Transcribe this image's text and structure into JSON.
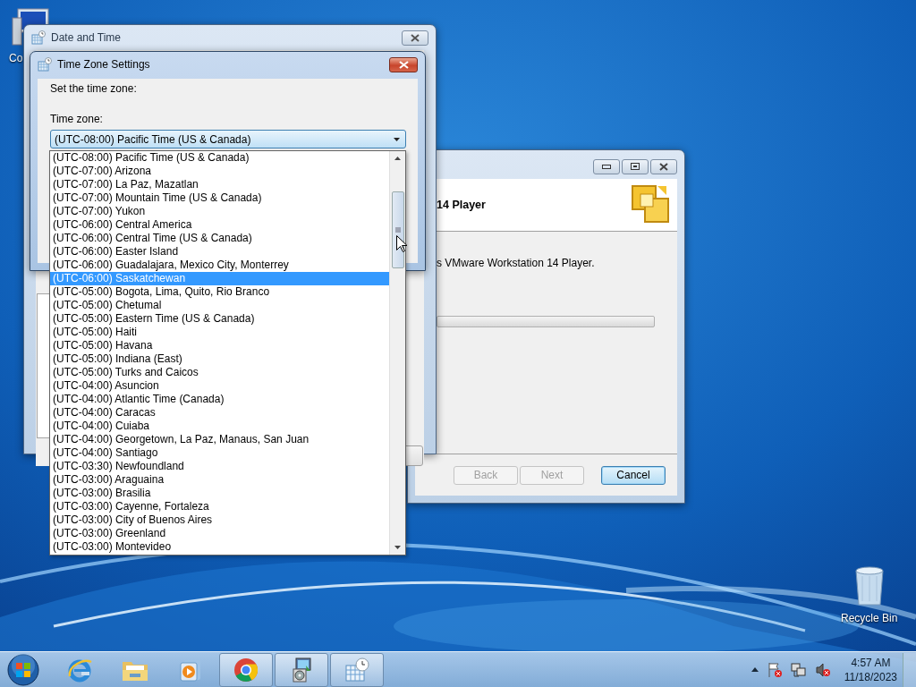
{
  "desktop": {
    "computer_label": "Co",
    "recycle_bin_label": "Recycle Bin"
  },
  "installer_window": {
    "heading": "14 Player",
    "description": "s VMware Workstation 14 Player.",
    "progress": {
      "level": 0
    },
    "buttons": [
      {
        "label": "Back",
        "disabled": true,
        "focused": false
      },
      {
        "label": "Next",
        "disabled": true,
        "focused": false
      },
      {
        "label": "Cancel",
        "disabled": false,
        "focused": true
      }
    ]
  },
  "date_time_window": {
    "title": "Date and Time"
  },
  "time_zone_dialog": {
    "title": "Time Zone Settings",
    "prompt": "Set the time zone:",
    "field_label": "Time zone:",
    "combo_value": "(UTC-08:00) Pacific Time (US & Canada)",
    "options": [
      {
        "label": "(UTC-08:00) Pacific Time (US & Canada)",
        "selected": false
      },
      {
        "label": "(UTC-07:00) Arizona",
        "selected": false
      },
      {
        "label": "(UTC-07:00) La Paz, Mazatlan",
        "selected": false
      },
      {
        "label": "(UTC-07:00) Mountain Time (US & Canada)",
        "selected": false
      },
      {
        "label": "(UTC-07:00) Yukon",
        "selected": false
      },
      {
        "label": "(UTC-06:00) Central America",
        "selected": false
      },
      {
        "label": "(UTC-06:00) Central Time (US & Canada)",
        "selected": false
      },
      {
        "label": "(UTC-06:00) Easter Island",
        "selected": false
      },
      {
        "label": "(UTC-06:00) Guadalajara, Mexico City, Monterrey",
        "selected": false
      },
      {
        "label": "(UTC-06:00) Saskatchewan",
        "selected": true
      },
      {
        "label": "(UTC-05:00) Bogota, Lima, Quito, Rio Branco",
        "selected": false
      },
      {
        "label": "(UTC-05:00) Chetumal",
        "selected": false
      },
      {
        "label": "(UTC-05:00) Eastern Time (US & Canada)",
        "selected": false
      },
      {
        "label": "(UTC-05:00) Haiti",
        "selected": false
      },
      {
        "label": "(UTC-05:00) Havana",
        "selected": false
      },
      {
        "label": "(UTC-05:00) Indiana (East)",
        "selected": false
      },
      {
        "label": "(UTC-05:00) Turks and Caicos",
        "selected": false
      },
      {
        "label": "(UTC-04:00) Asuncion",
        "selected": false
      },
      {
        "label": "(UTC-04:00) Atlantic Time (Canada)",
        "selected": false
      },
      {
        "label": "(UTC-04:00) Caracas",
        "selected": false
      },
      {
        "label": "(UTC-04:00) Cuiaba",
        "selected": false
      },
      {
        "label": "(UTC-04:00) Georgetown, La Paz, Manaus, San Juan",
        "selected": false
      },
      {
        "label": "(UTC-04:00) Santiago",
        "selected": false
      },
      {
        "label": "(UTC-03:30) Newfoundland",
        "selected": false
      },
      {
        "label": "(UTC-03:00) Araguaina",
        "selected": false
      },
      {
        "label": "(UTC-03:00) Brasilia",
        "selected": false
      },
      {
        "label": "(UTC-03:00) Cayenne, Fortaleza",
        "selected": false
      },
      {
        "label": "(UTC-03:00) City of Buenos Aires",
        "selected": false
      },
      {
        "label": "(UTC-03:00) Greenland",
        "selected": false
      },
      {
        "label": "(UTC-03:00) Montevideo",
        "selected": false
      }
    ]
  },
  "taskbar": {
    "buttons": [
      {
        "kind": "browser-e",
        "running": false
      },
      {
        "kind": "folder",
        "running": false
      },
      {
        "kind": "media",
        "running": false
      },
      {
        "kind": "chrome",
        "running": true
      },
      {
        "kind": "installer",
        "running": true
      },
      {
        "kind": "calendar",
        "running": true
      }
    ],
    "time": "4:57 AM",
    "date": "11/18/2023"
  }
}
